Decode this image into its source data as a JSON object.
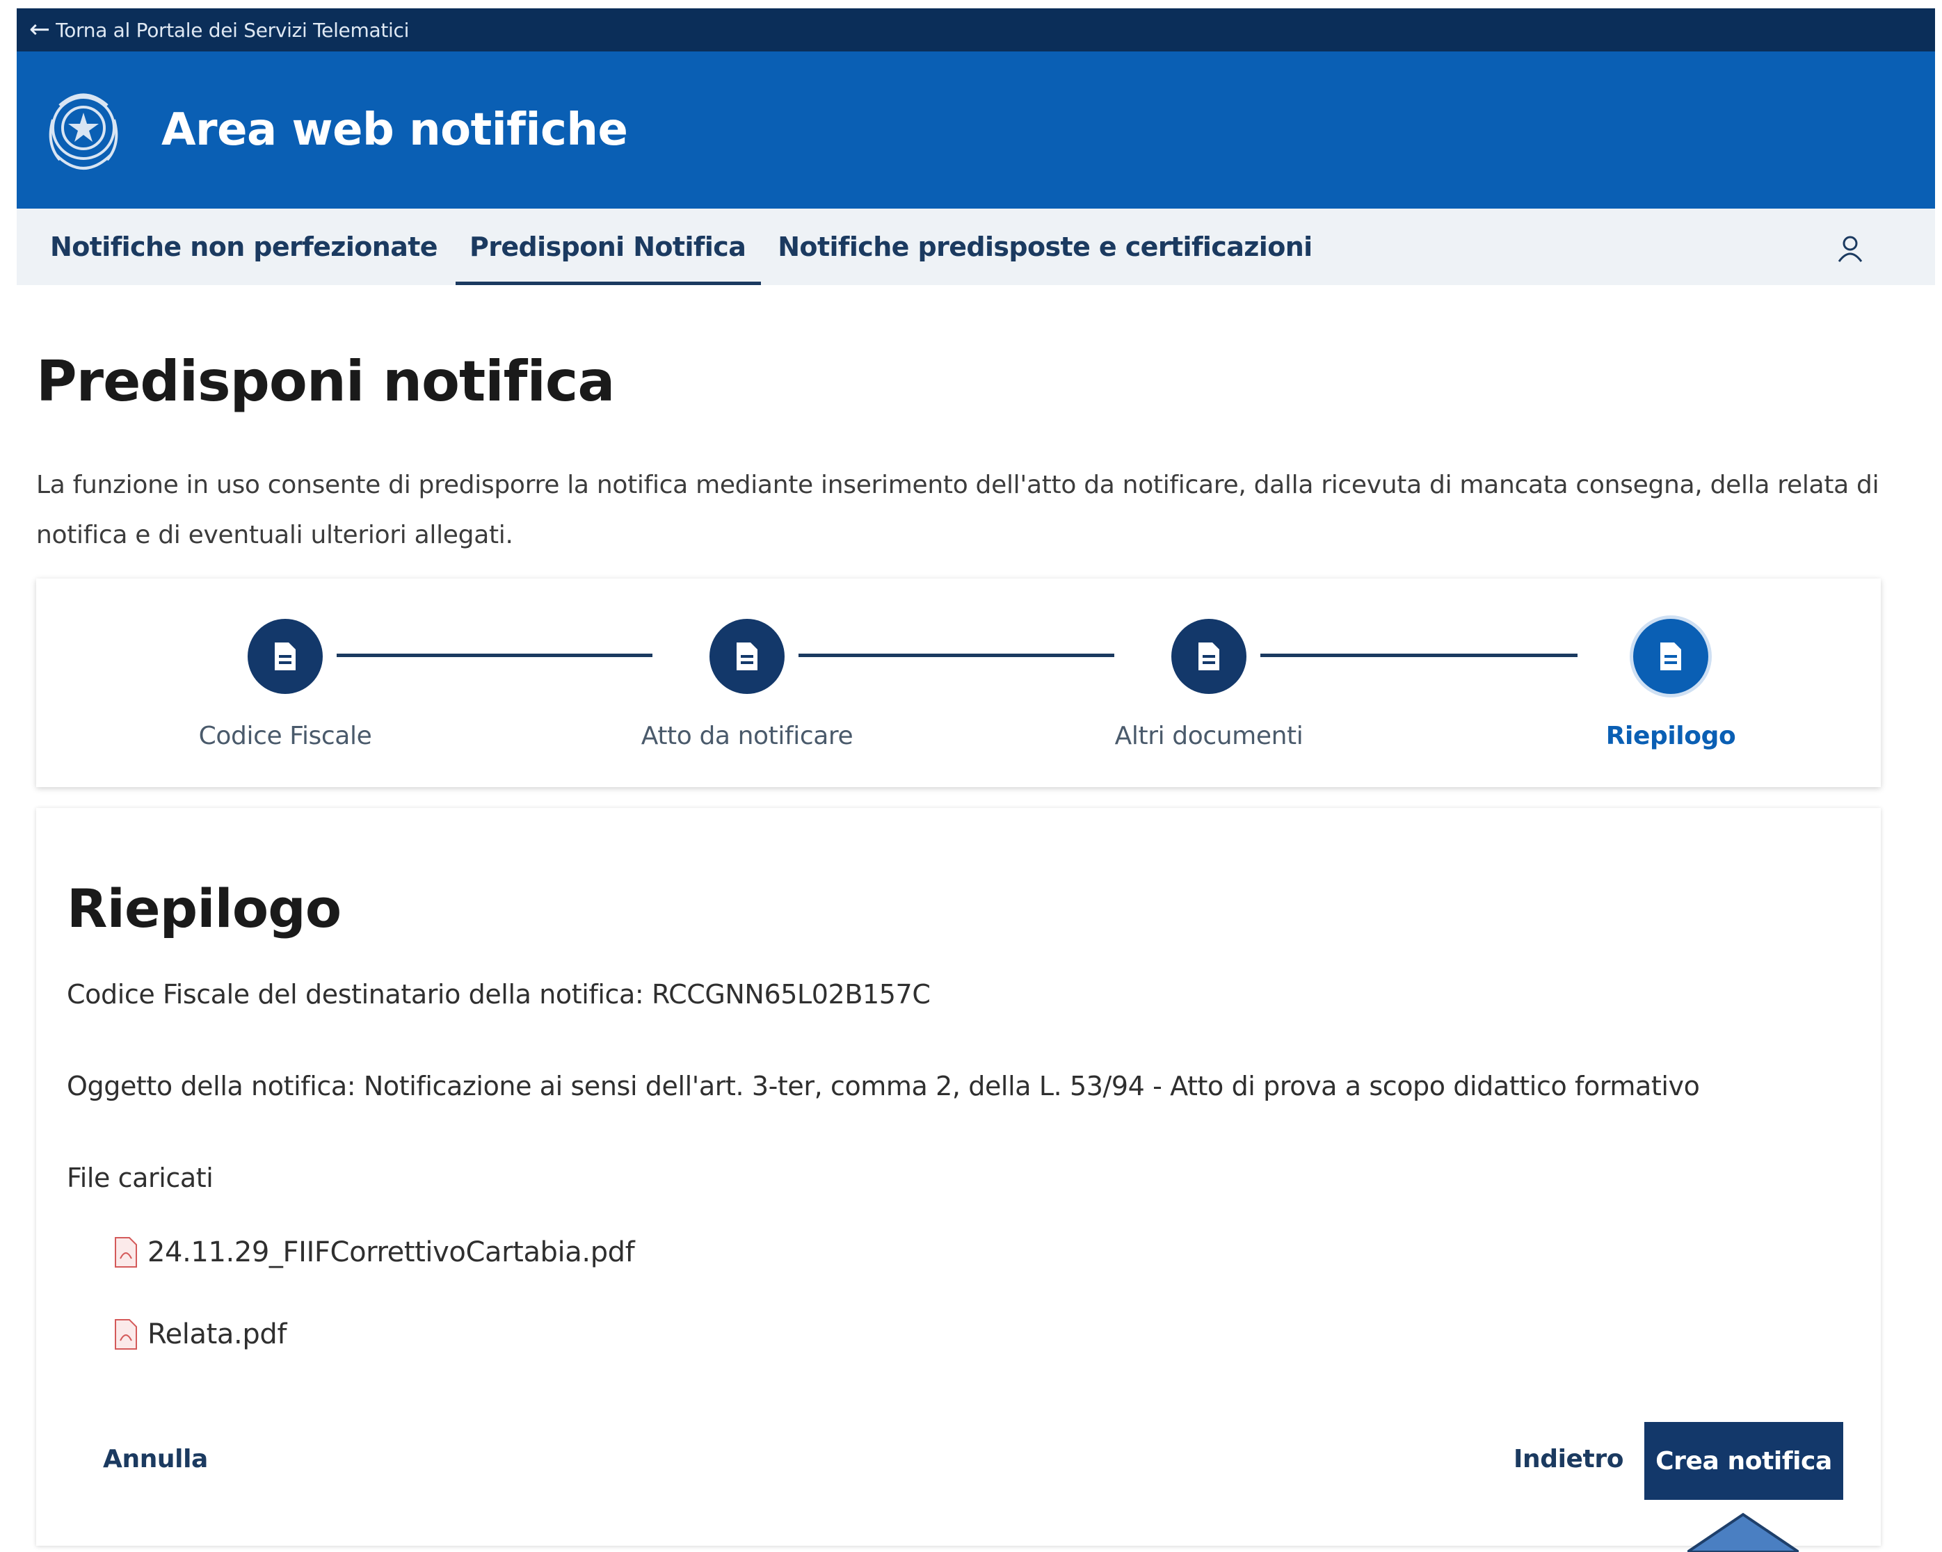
{
  "topbar": {
    "back_link": "Torna al Portale dei Servizi Telematici"
  },
  "header": {
    "title": "Area web notifiche"
  },
  "nav": {
    "items": [
      {
        "label": "Notifiche non perfezionate"
      },
      {
        "label": "Predisponi Notifica"
      },
      {
        "label": "Notifiche predisposte e certificazioni"
      }
    ],
    "active_index": 1
  },
  "page": {
    "title": "Predisponi notifica",
    "intro": "La funzione in uso consente di predisporre la notifica mediante inserimento dell'atto da notificare, dalla ricevuta di mancata consegna, della relata di notifica e di eventuali ulteriori allegati."
  },
  "stepper": {
    "steps": [
      {
        "label": "Codice Fiscale",
        "icon": "document-icon"
      },
      {
        "label": "Atto da notificare",
        "icon": "document-icon"
      },
      {
        "label": "Altri documenti",
        "icon": "document-icon"
      },
      {
        "label": "Riepilogo",
        "icon": "document-icon"
      }
    ],
    "current_index": 3
  },
  "summary": {
    "title": "Riepilogo",
    "codice_fiscale": "Codice Fiscale del destinatario della notifica: RCCGNN65L02B157C",
    "oggetto": "Oggetto della notifica: Notificazione ai sensi dell'art. 3-ter, comma 2, della L. 53/94 - Atto di prova a scopo didattico formativo",
    "files_label": "File caricati",
    "files": [
      {
        "name": "24.11.29_FIIFCorrettivoCartabia.pdf",
        "icon": "pdf-icon"
      },
      {
        "name": "Relata.pdf",
        "icon": "pdf-icon"
      }
    ]
  },
  "actions": {
    "cancel": "Annulla",
    "back": "Indietro",
    "create": "Crea notifica"
  },
  "colors": {
    "topbar": "#0b2e59",
    "header": "#0a5fb4",
    "primary_dark": "#13386a",
    "nav_bg": "#eef2f6"
  }
}
